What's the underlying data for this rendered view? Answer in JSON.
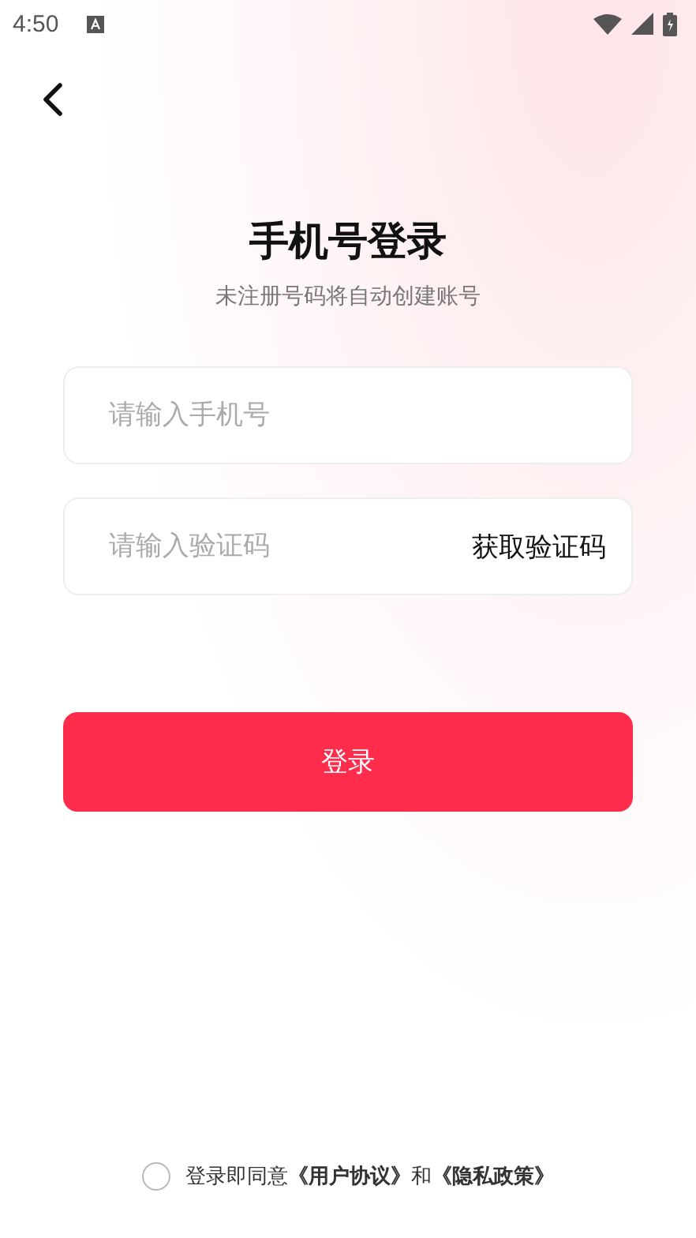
{
  "status_bar": {
    "time": "4:50"
  },
  "title": "手机号登录",
  "subtitle": "未注册号码将自动创建账号",
  "fields": [
    {
      "kind": "phone",
      "placeholder": "请输入手机号"
    },
    {
      "kind": "code",
      "placeholder": "请输入验证码",
      "action": "获取验证码"
    }
  ],
  "login_button": "登录",
  "agreement": {
    "checked": false,
    "text": "登录即同意**《用户协议》**和**《隐私政策》**"
  }
}
